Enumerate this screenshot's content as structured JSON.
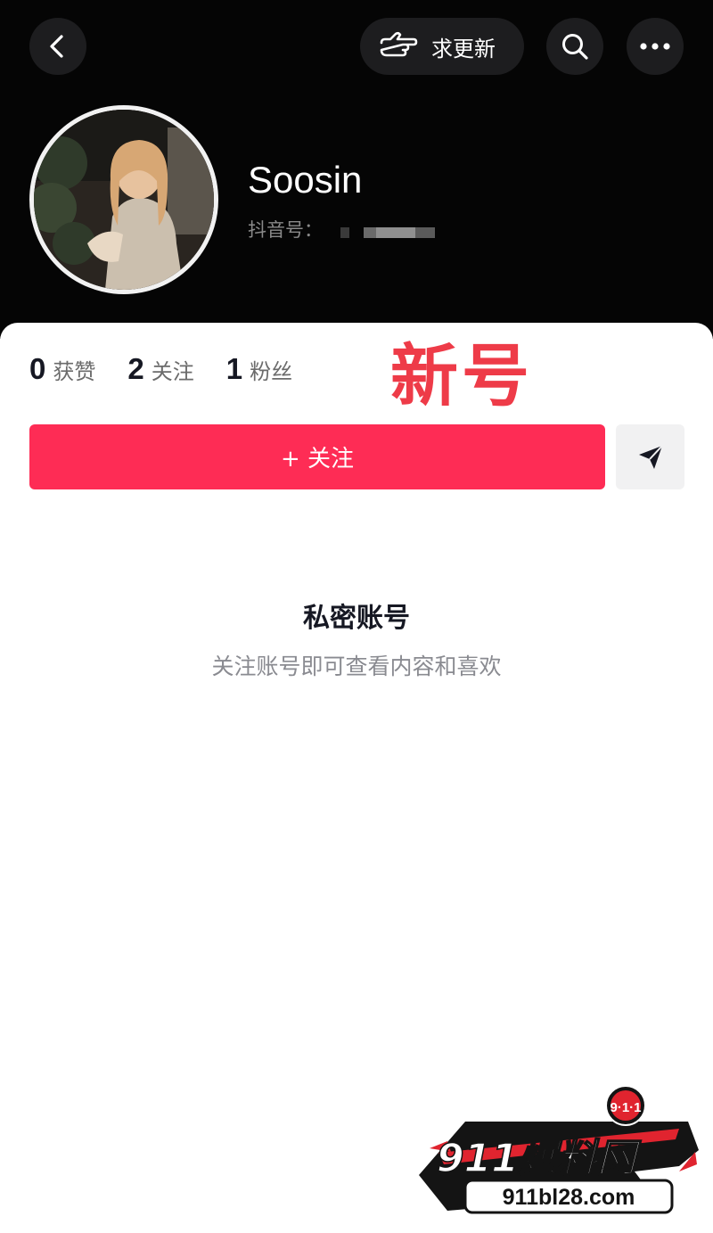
{
  "header": {
    "back_icon": "chevron-left-icon",
    "request_update_icon": "pointing-hand-icon",
    "request_update_label": "求更新",
    "search_icon": "search-icon",
    "more_icon": "more-dots-icon"
  },
  "profile": {
    "username": "Soosin",
    "douyin_id_label": "抖音号："
  },
  "stats": [
    {
      "value": "0",
      "label": "获赞"
    },
    {
      "value": "2",
      "label": "关注"
    },
    {
      "value": "1",
      "label": "粉丝"
    }
  ],
  "overlay_text": "新号",
  "actions": {
    "follow_label": "+ 关注",
    "share_icon": "send-arrow-icon"
  },
  "private_notice": {
    "title": "私密账号",
    "description": "关注账号即可查看内容和喜欢"
  },
  "watermark": {
    "badge": "9·1·1",
    "brand": "911爆料网",
    "url": "911bl28.com"
  },
  "colors": {
    "follow_button": "#fe2c55",
    "overlay_text": "#ee3b48",
    "header_bg": "#050505"
  }
}
